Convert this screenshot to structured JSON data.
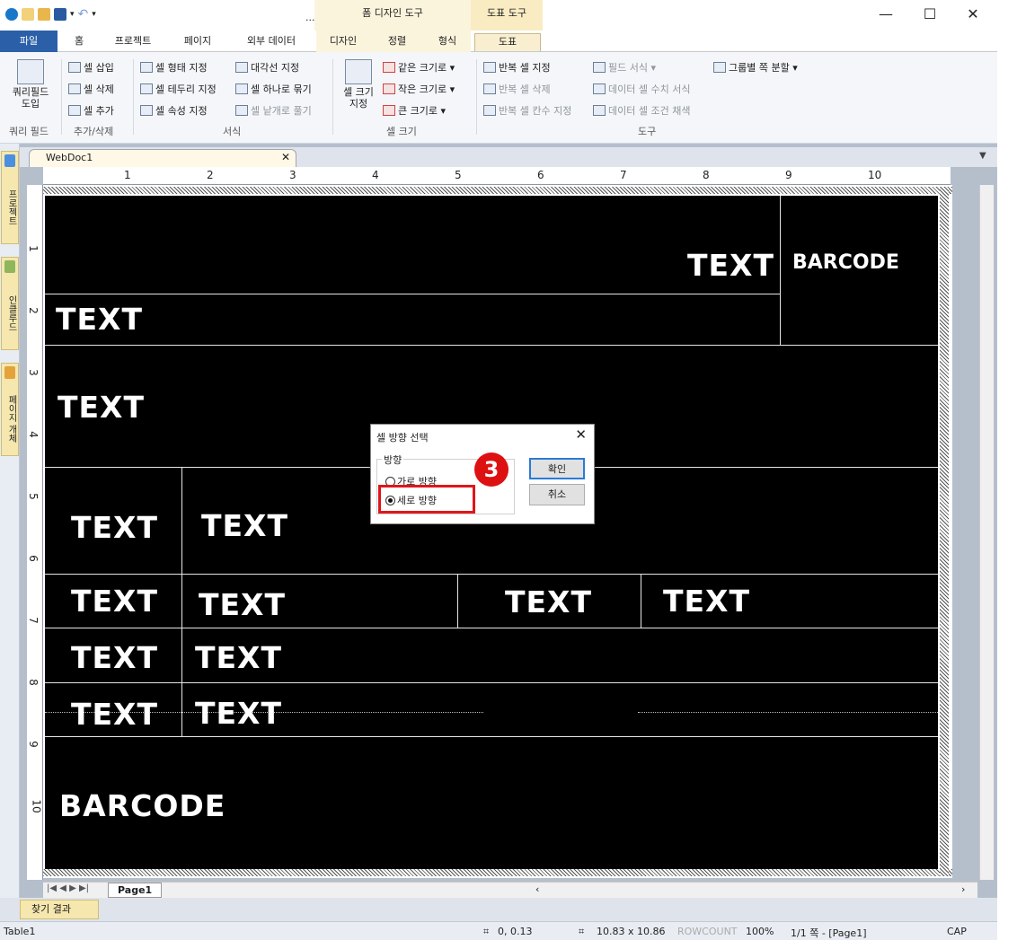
{
  "title_bar": {
    "context_group_1": "폼 디자인 도구",
    "context_group_2": "도표 도구",
    "ellipsis": "..."
  },
  "tabs": [
    "파일",
    "홈",
    "프로젝트",
    "페이지",
    "외부 데이터",
    "디자인",
    "정렬",
    "형식",
    "도표"
  ],
  "ribbon": {
    "query_field": {
      "label_line1": "쿼리필드",
      "label_line2": "도입",
      "group": "쿼리 필드"
    },
    "add_delete": {
      "items": [
        "셀 삽입",
        "셀 삭제",
        "셀 추가"
      ],
      "group": "추가/삭제"
    },
    "format_col1": [
      "셀 형태 지정",
      "셀 테두리 지정",
      "셀 속성 지정"
    ],
    "format_col2": [
      "대각선 지정",
      "셀 하나로 묶기",
      "셀 낱개로 풀기"
    ],
    "format_group": "서식",
    "cell_size_btn_line1": "셀 크기",
    "cell_size_btn_line2": "지정",
    "cell_size_items": [
      "같은 크기로 ▾",
      "작은 크기로 ▾",
      "큰 크기로 ▾"
    ],
    "cell_size_group": "셀 크기",
    "tools_col1": [
      "반복 셀 지정",
      "반복 셀 삭제",
      "반복 셀 칸수 지정"
    ],
    "tools_col2": [
      "필드 서식 ▾",
      "데이터 셀 수치 서식",
      "데이터 셀 조건 채색"
    ],
    "tools_col3": [
      "그룹별 쪽 분할 ▾"
    ],
    "tools_group": "도구"
  },
  "left_panels": [
    "프로젝트",
    "인클루드",
    "페이지 개체"
  ],
  "document": {
    "tab_name": "WebDoc1",
    "ruler_h": [
      "1",
      "2",
      "3",
      "4",
      "5",
      "6",
      "7",
      "8",
      "9",
      "10"
    ],
    "ruler_v": [
      "1",
      "2",
      "3",
      "4",
      "5",
      "6",
      "7",
      "8",
      "9",
      "10"
    ],
    "cells": {
      "text": "TEXT",
      "barcode": "BARCODE"
    },
    "page_tab": "Page1"
  },
  "dialog": {
    "title": "셀 방향 선택",
    "group_label": "방향",
    "option_horizontal": "가로 방향",
    "option_vertical": "세로 방향",
    "selected": "세로 방향",
    "ok": "확인",
    "cancel": "취소",
    "step_marker": "3"
  },
  "find_bar": {
    "tab": "찾기 결과"
  },
  "status": {
    "object": "Table1",
    "position": "0,  0.13",
    "size": "10.83 x 10.86",
    "rowcount": "ROWCOUNT",
    "zoom": "100%",
    "page_info": "1/1 쪽 - [Page1]",
    "caps": "CAP"
  },
  "colors": {
    "file_tab": "#2b5fa8",
    "context_tab": "#f9efd0",
    "accent_red": "#e0151b",
    "canvas": "#000000"
  }
}
